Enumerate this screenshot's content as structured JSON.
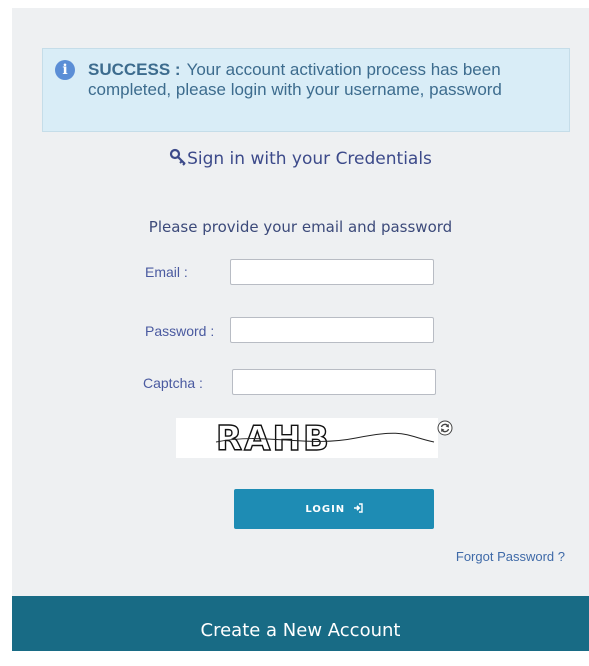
{
  "alert": {
    "icon": "info-icon",
    "icon_glyph": "i",
    "title": "SUCCESS :",
    "message": "Your account activation process has been completed, please login with your username, password"
  },
  "signin": {
    "icon": "key-icon",
    "title": "Sign in with your Credentials"
  },
  "form": {
    "instructions": "Please provide your email and password",
    "email_label": "Email :",
    "email_value": "",
    "password_label": "Password :",
    "password_value": "",
    "captcha_label": "Captcha :",
    "captcha_value": "",
    "captcha_text": "RAHB",
    "refresh_icon": "refresh-icon",
    "login_label": "LOGIN",
    "login_icon": "sign-in-icon",
    "forgot_label": "Forgot Password ?"
  },
  "footer": {
    "create_label": "Create a New Account"
  },
  "colors": {
    "panel_bg": "#eef0f2",
    "alert_bg": "#d9edf7",
    "alert_text": "#3d6c8e",
    "accent": "#1e8cb4",
    "footer_bg": "#186b85"
  }
}
